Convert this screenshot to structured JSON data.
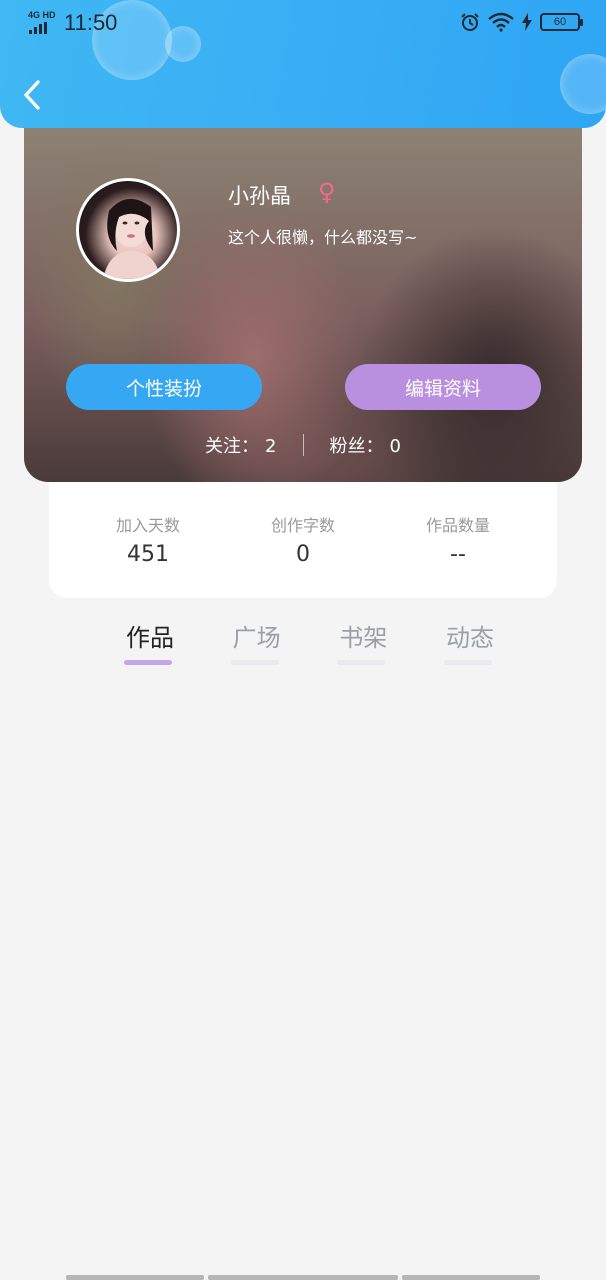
{
  "status_bar": {
    "network": "4G HD",
    "time": "11:50",
    "battery": "60"
  },
  "profile": {
    "username": "小孙晶",
    "gender_symbol": "♀",
    "bio": "这个人很懒，什么都没写~",
    "follow_label": "关注：",
    "follow_count": "2",
    "fans_label": "粉丝：",
    "fans_count": "0",
    "dress_button": "个性装扮",
    "edit_button": "编辑资料"
  },
  "stats": [
    {
      "label": "加入天数",
      "value": "451"
    },
    {
      "label": "创作字数",
      "value": "0"
    },
    {
      "label": "作品数量",
      "value": "--"
    }
  ],
  "tabs": [
    {
      "label": "作品",
      "active": true
    },
    {
      "label": "广场",
      "active": false
    },
    {
      "label": "书架",
      "active": false
    },
    {
      "label": "动态",
      "active": false
    }
  ],
  "colors": {
    "header_blue": "#3aaef4",
    "dress_button": "#36a7f2",
    "edit_button": "#b98fe0",
    "tab_indicator": "#c4a6e6",
    "gender": "#ef6a8d"
  }
}
